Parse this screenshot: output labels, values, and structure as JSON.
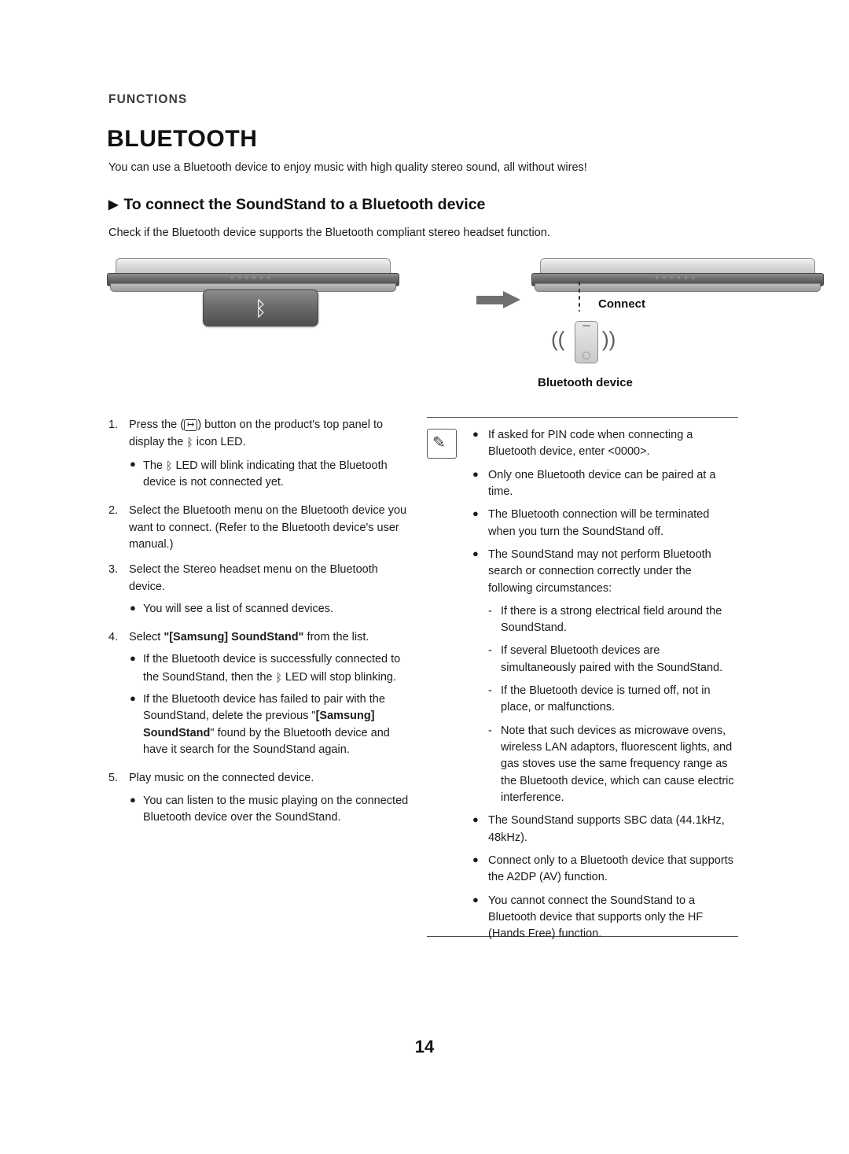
{
  "header": {
    "section_label": "FUNCTIONS",
    "title": "BLUETOOTH",
    "intro": "You can use a Bluetooth device to enjoy music with high quality stereo sound, all without wires!",
    "sub_head": "To connect the SoundStand to a Bluetooth device",
    "sub_head_arrow": "▶",
    "sub_note": "Check if the Bluetooth device supports the Bluetooth compliant stereo headset function."
  },
  "figure": {
    "bluetooth_glyph": "ᛒ",
    "soundbar_buttons": "○○○○○○",
    "connect_label": "Connect",
    "bluetooth_device_label": "Bluetooth device",
    "wave_left": "((",
    "wave_right": "))"
  },
  "steps": {
    "s1_num": "1.",
    "s1_a": "Press the (",
    "s1_btn": "↦",
    "s1_b": ") button on the product's top panel to display the ",
    "s1_c": " icon LED.",
    "s1_bullet_a": "The ",
    "s1_bullet_b": " LED will blink indicating that the Bluetooth device is not connected yet.",
    "s2_num": "2.",
    "s2": "Select the Bluetooth menu on the Bluetooth device you want to connect. (Refer to the Bluetooth device's user manual.)",
    "s3_num": "3.",
    "s3": "Select the Stereo headset menu on the Bluetooth device.",
    "s3_bullet": "You will see a list of scanned devices.",
    "s4_num": "4.",
    "s4_a": "Select ",
    "s4_bold": "\"[Samsung] SoundStand\"",
    "s4_b": " from the list.",
    "s4_bullet1_a": "If the Bluetooth device is successfully connected to the SoundStand, then the ",
    "s4_bullet1_b": " LED will stop blinking.",
    "s4_bullet2_a": "If the Bluetooth device has failed to pair with the SoundStand, delete the previous \"",
    "s4_bullet2_bold": "[Samsung] SoundStand",
    "s4_bullet2_b": "\" found by the Bluetooth device and have it search for the SoundStand again.",
    "s5_num": "5.",
    "s5": "Play music on the connected device.",
    "s5_bullet": "You can listen to the music playing on the connected Bluetooth device over the SoundStand."
  },
  "notes": {
    "items": [
      {
        "type": "bullet",
        "text": "If asked for PIN code when connecting a Bluetooth device, enter <0000>."
      },
      {
        "type": "bullet",
        "text": "Only one Bluetooth device can be paired at a time."
      },
      {
        "type": "bullet",
        "text": "The Bluetooth connection will be terminated when you turn the SoundStand off."
      },
      {
        "type": "bullet",
        "text": "The SoundStand may not perform Bluetooth search or connection correctly under the following circumstances:"
      },
      {
        "type": "dash",
        "text": "If there is a strong electrical field around the SoundStand."
      },
      {
        "type": "dash",
        "text": "If several Bluetooth devices are simultaneously paired with the SoundStand."
      },
      {
        "type": "dash",
        "text": "If the Bluetooth device is turned off, not in place, or malfunctions."
      },
      {
        "type": "dash",
        "text": "Note that such devices as microwave ovens, wireless LAN adaptors, fluorescent lights, and gas stoves use the same frequency range as the Bluetooth device, which can cause electric interference."
      },
      {
        "type": "bullet",
        "text": "The SoundStand supports SBC data (44.1kHz, 48kHz)."
      },
      {
        "type": "bullet",
        "text": "Connect only to a Bluetooth device that supports the A2DP (AV) function."
      },
      {
        "type": "bullet",
        "text": "You cannot connect the SoundStand to a Bluetooth device that supports only the HF (Hands Free) function."
      }
    ],
    "bullet_char": "●",
    "dash_char": "-",
    "note_icon_glyph": "✎"
  },
  "footer": {
    "page_number": "14"
  }
}
